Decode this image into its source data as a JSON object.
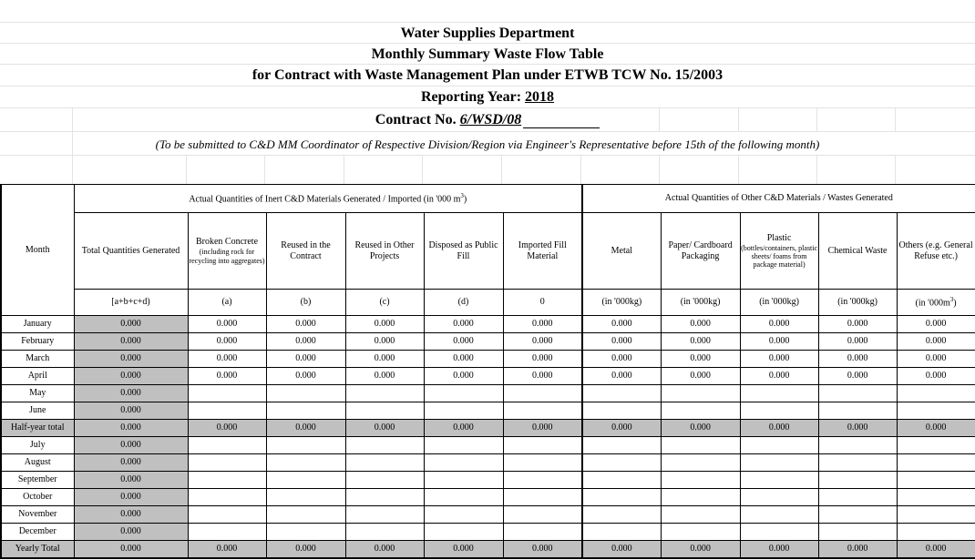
{
  "header": {
    "department": "Water Supplies Department",
    "table_title": "Monthly Summary Waste Flow Table",
    "plan_line": "for Contract with Waste Management Plan under ETWB TCW No. 15/2003",
    "reporting_year_label": "Reporting Year:",
    "reporting_year": "2018",
    "contract_label": "Contract No.",
    "contract_no": "6/WSD/08",
    "note": "(To be submitted to C&D MM Coordinator of Respective Division/Region via Engineer's Representative before 15th of the following month)"
  },
  "groups": {
    "inert_prefix": "Actual Quantities of Inert C&D Materials Generated / Imported (in '000 m",
    "inert_sup": "3",
    "inert_suffix": ")",
    "other": "Actual Quantities of Other C&D Materials / Wastes Generated"
  },
  "columns": {
    "month": "Month",
    "total": "Total Quantities Generated",
    "broken_concrete_main": "Broken Concrete",
    "broken_concrete_sub": "(including rock for recycling into aggregates)",
    "reused_contract": "Reused in the Contract",
    "reused_other": "Reused in Other Projects",
    "disposed": "Disposed as Public Fill",
    "imported": "Imported Fill Material",
    "metal": "Metal",
    "paper": "Paper/ Cardboard Packaging",
    "plastic_main": "Plastic",
    "plastic_sub": "(bottles/containers, plastic sheets/ foams from package material)",
    "chemical": "Chemical Waste",
    "others_main": "Others (e.g. General Refuse etc.)"
  },
  "units": {
    "total": "[a+b+c+d)",
    "a": "(a)",
    "b": "(b)",
    "c": "(c)",
    "d": "(d)",
    "e": "0",
    "metal": "(in '000kg)",
    "paper": "(in '000kg)",
    "plastic": "(in '000kg)",
    "chemical": "(in '000kg)",
    "others_prefix": "(in '000m",
    "others_sup": "3",
    "others_suffix": ")"
  },
  "rows": [
    {
      "month": "January",
      "total": "0.000",
      "values": [
        "0.000",
        "0.000",
        "0.000",
        "0.000",
        "0.000",
        "0.000",
        "0.000",
        "0.000",
        "0.000",
        "0.000"
      ]
    },
    {
      "month": "February",
      "total": "0.000",
      "values": [
        "0.000",
        "0.000",
        "0.000",
        "0.000",
        "0.000",
        "0.000",
        "0.000",
        "0.000",
        "0.000",
        "0.000"
      ]
    },
    {
      "month": "March",
      "total": "0.000",
      "values": [
        "0.000",
        "0.000",
        "0.000",
        "0.000",
        "0.000",
        "0.000",
        "0.000",
        "0.000",
        "0.000",
        "0.000"
      ]
    },
    {
      "month": "April",
      "total": "0.000",
      "values": [
        "0.000",
        "0.000",
        "0.000",
        "0.000",
        "0.000",
        "0.000",
        "0.000",
        "0.000",
        "0.000",
        "0.000"
      ]
    },
    {
      "month": "May",
      "total": "0.000",
      "values": [
        "",
        "",
        "",
        "",
        "",
        "",
        "",
        "",
        "",
        ""
      ]
    },
    {
      "month": "June",
      "total": "0.000",
      "values": [
        "",
        "",
        "",
        "",
        "",
        "",
        "",
        "",
        "",
        ""
      ]
    },
    {
      "month": "Half-year total",
      "total": "0.000",
      "values": [
        "0.000",
        "0.000",
        "0.000",
        "0.000",
        "0.000",
        "0.000",
        "0.000",
        "0.000",
        "0.000",
        "0.000"
      ],
      "summary": true
    },
    {
      "month": "July",
      "total": "0.000",
      "values": [
        "",
        "",
        "",
        "",
        "",
        "",
        "",
        "",
        "",
        ""
      ]
    },
    {
      "month": "August",
      "total": "0.000",
      "values": [
        "",
        "",
        "",
        "",
        "",
        "",
        "",
        "",
        "",
        ""
      ]
    },
    {
      "month": "September",
      "total": "0.000",
      "values": [
        "",
        "",
        "",
        "",
        "",
        "",
        "",
        "",
        "",
        ""
      ]
    },
    {
      "month": "October",
      "total": "0.000",
      "values": [
        "",
        "",
        "",
        "",
        "",
        "",
        "",
        "",
        "",
        ""
      ]
    },
    {
      "month": "November",
      "total": "0.000",
      "values": [
        "",
        "",
        "",
        "",
        "",
        "",
        "",
        "",
        "",
        ""
      ]
    },
    {
      "month": "December",
      "total": "0.000",
      "values": [
        "",
        "",
        "",
        "",
        "",
        "",
        "",
        "",
        "",
        ""
      ]
    },
    {
      "month": "Yearly Total",
      "total": "0.000",
      "values": [
        "0.000",
        "0.000",
        "0.000",
        "0.000",
        "0.000",
        "0.000",
        "0.000",
        "0.000",
        "0.000",
        "0.000"
      ],
      "summary": true
    }
  ]
}
